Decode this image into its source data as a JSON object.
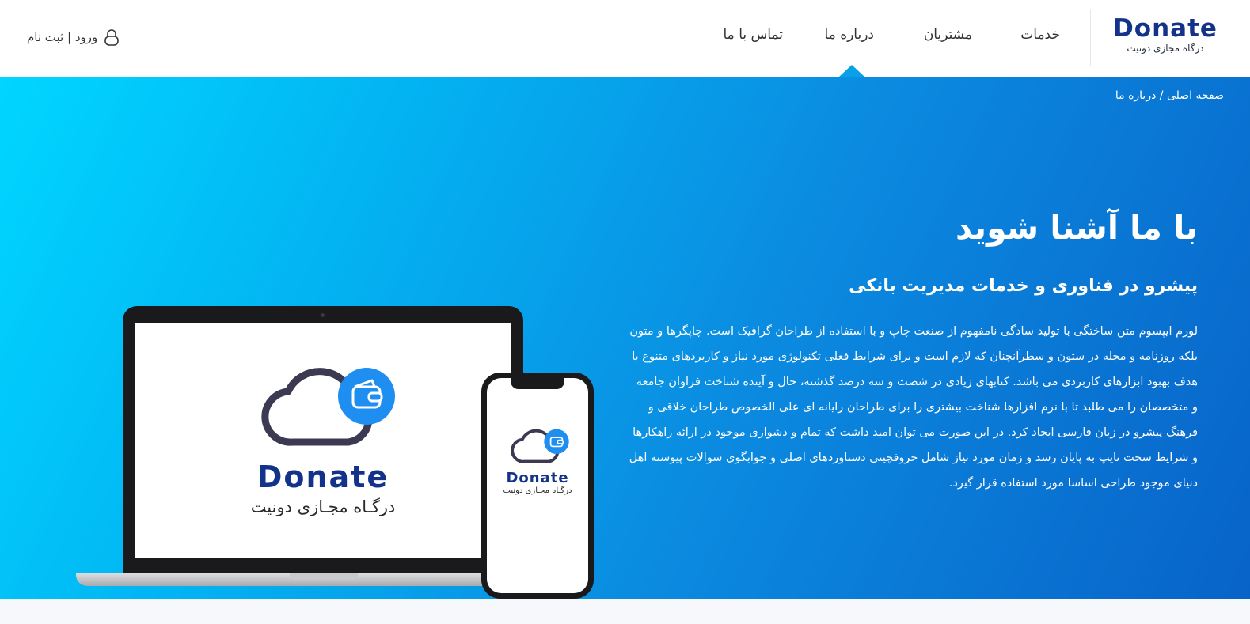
{
  "header": {
    "logo_word": "Donate",
    "logo_sub": "درگاه مجازی دونیت",
    "nav": {
      "services": "خدمات",
      "customers": "مشتریان",
      "about": "درباره ما",
      "contact": "تماس با ما"
    },
    "auth_label": "ورود | ثبت نام",
    "active_nav": "about"
  },
  "breadcrumb": {
    "home": "صفحه اصلی",
    "separator": "/",
    "current": "درباره ما"
  },
  "hero": {
    "title": "با ما آشنا شوید",
    "subtitle": "پیشرو در فناوری و خدمات مدیریت بانکی",
    "body": "لورم ایپسوم متن ساختگی با تولید سادگی نامفهوم از صنعت چاپ و با استفاده از طراحان گرافیک است. چاپگرها و متون بلکه روزنامه و مجله در ستون و سطرآنچنان که لازم است و برای شرایط فعلی تکنولوژی مورد نیاز و کاربردهای متنوع با هدف بهبود ابزارهای کاربردی می باشد. کتابهای زیادی در شصت و سه درصد گذشته، حال و آینده شناخت فراوان جامعه و متخصصان را می طلبد تا با نرم افزارها شناخت بیشتری را برای طراحان رایانه ای علی الخصوص طراحان خلاقی و فرهنگ پیشرو در زبان فارسی ایجاد کرد. در این صورت می توان امید داشت که تمام و دشواری موجود در ارائه راهکارها و شرایط سخت تایپ به پایان رسد و زمان مورد نیاز شامل حروفچینی دستاوردهای اصلی و جوابگوی سوالات پیوسته اهل دنیای موجود طراحی اساسا مورد استفاده قرار گیرد."
  },
  "devices": {
    "laptop_logo_word": "Donate",
    "laptop_logo_sub": "درگـاه مجـازی دونیت",
    "phone_logo_word": "Donate",
    "phone_logo_sub": "درگـاه مجـازی دونیت"
  },
  "colors": {
    "brand_navy": "#13328a",
    "brand_blue": "#1f8ef1",
    "hero_gradient_start": "#00d6ff",
    "hero_gradient_end": "#0863c8",
    "cloud_outline": "#3c3a52"
  },
  "icons": {
    "auth": "lock-icon",
    "brand": "cloud-wallet-icon"
  }
}
